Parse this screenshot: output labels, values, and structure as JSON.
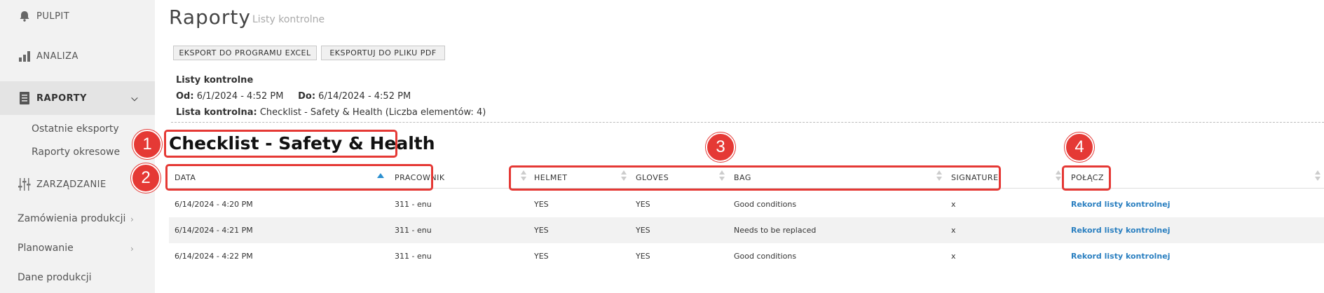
{
  "sidebar": {
    "items": [
      {
        "label": "PULPIT",
        "icon": "bell-icon"
      },
      {
        "label": "ANALIZA",
        "icon": "bar-chart-icon"
      },
      {
        "label": "RAPORTY",
        "icon": "report-icon"
      },
      {
        "label": "ZARZĄDZANIE",
        "icon": "sliders-icon"
      }
    ],
    "raporty_sub": [
      "Ostatnie eksporty",
      "Raporty okresowe"
    ],
    "zarzadzanie_sub": [
      "Zamówienia produkcji",
      "Planowanie",
      "Dane produkcji"
    ]
  },
  "header": {
    "title": "Raporty",
    "subtitle": "Listy kontrolne"
  },
  "toolbar": {
    "excel_label": "EKSPORT DO PROGRAMU EXCEL",
    "pdf_label": "EKSPORTUJ DO PLIKU PDF"
  },
  "info": {
    "heading": "Listy kontrolne",
    "od_label": "Od:",
    "od_value": "6/1/2024 - 4:52 PM",
    "do_label": "Do:",
    "do_value": "6/14/2024 - 4:52 PM",
    "lista_label": "Lista kontrolna:",
    "lista_value": "Checklist - Safety & Health (Liczba elementów: 4)"
  },
  "checklist_title": "Checklist - Safety & Health",
  "table": {
    "columns": [
      "DATA",
      "PRACOWNIK",
      "HELMET",
      "GLOVES",
      "BAG",
      "SIGNATURE",
      "POŁĄCZ"
    ],
    "rows": [
      [
        "6/14/2024 - 4:20 PM",
        "311 - enu",
        "YES",
        "YES",
        "Good conditions",
        "x",
        "Rekord listy kontrolnej"
      ],
      [
        "6/14/2024 - 4:21 PM",
        "311 - enu",
        "YES",
        "YES",
        "Needs to be replaced",
        "x",
        "Rekord listy kontrolnej"
      ],
      [
        "6/14/2024 - 4:22 PM",
        "311 - enu",
        "YES",
        "YES",
        "Good conditions",
        "x",
        "Rekord listy kontrolnej"
      ]
    ]
  },
  "annotations": [
    "1",
    "2",
    "3",
    "4"
  ],
  "colors": {
    "annotation": "#e53935",
    "link": "#2a7fc0",
    "sort_active": "#2a8fcf"
  }
}
